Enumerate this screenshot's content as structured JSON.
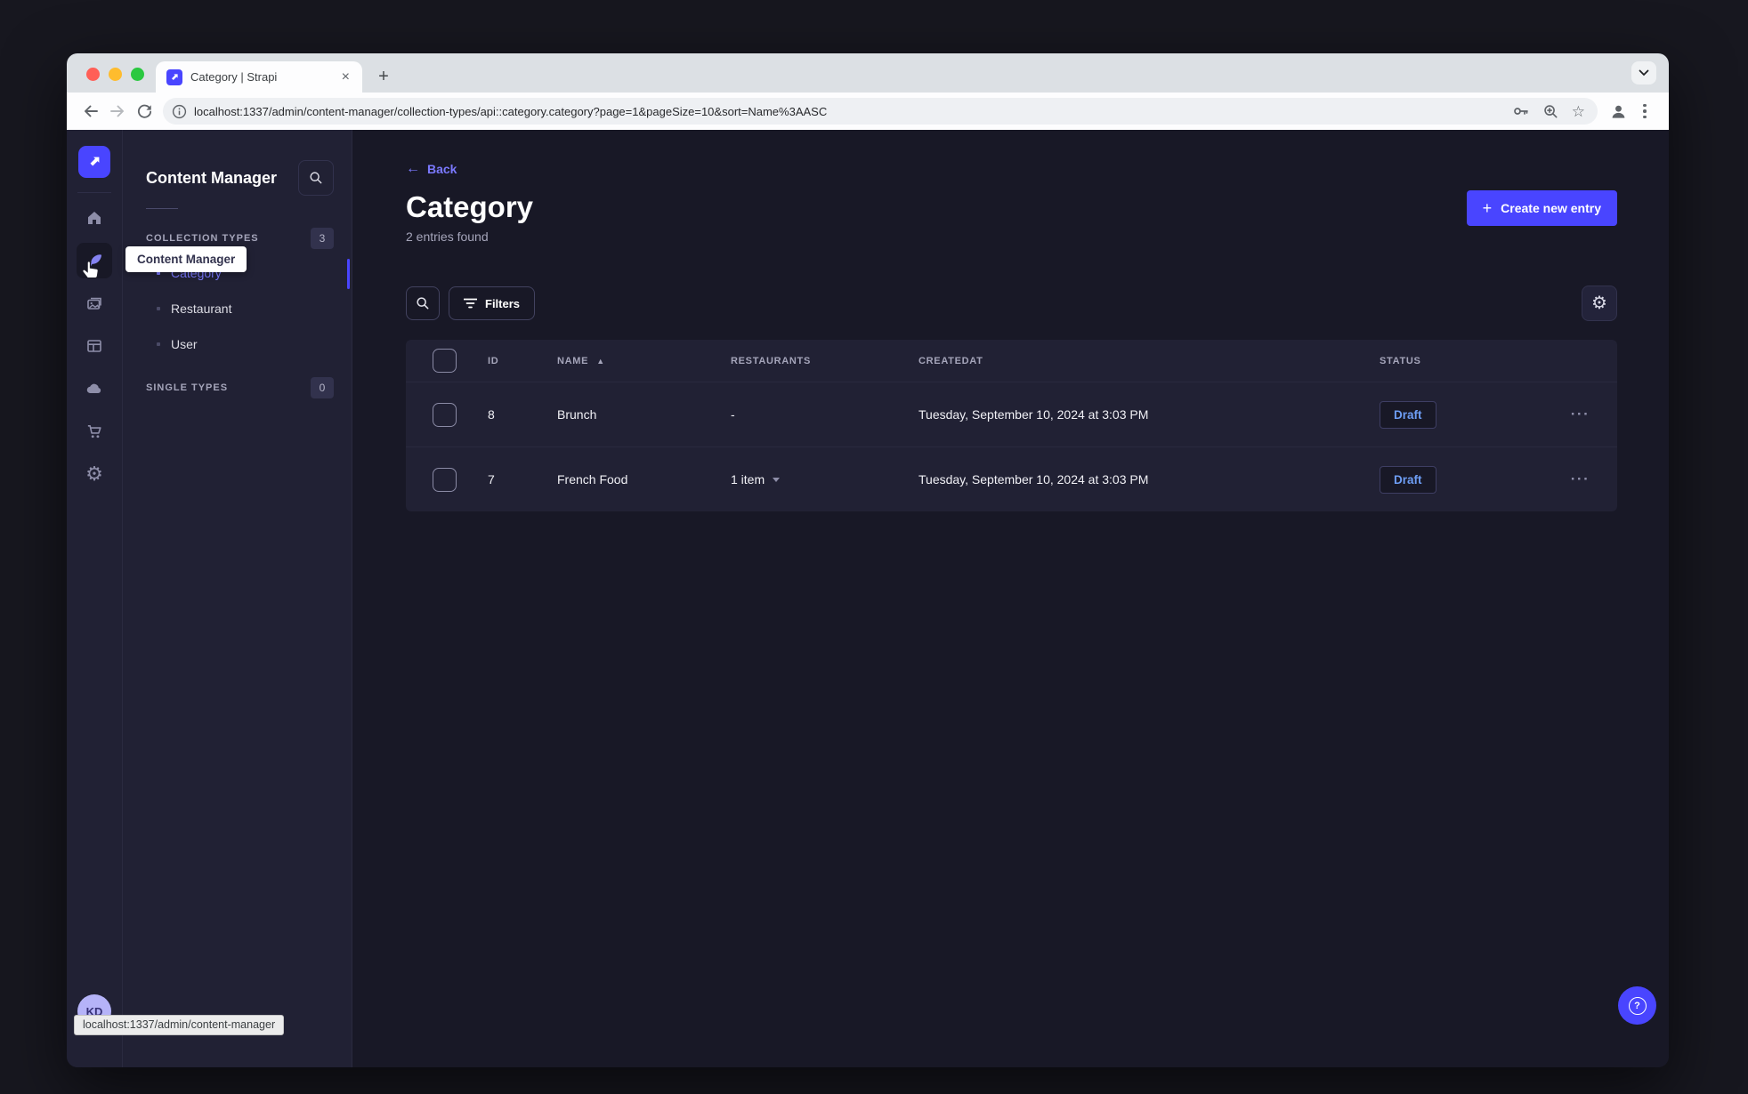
{
  "colors": {
    "primary": "#4945ff",
    "active_link": "#7b79ff",
    "draft_badge_text": "#6e9ef5",
    "app_background": "#181826",
    "surface": "#212134"
  },
  "browser": {
    "tab_title": "Category | Strapi",
    "new_tab_label": "+",
    "tab_close_label": "×",
    "url": "localhost:1337/admin/content-manager/collection-types/api::category.category?page=1&pageSize=10&sort=Name%3AASC",
    "status_preview": "localhost:1337/admin/content-manager"
  },
  "rail": {
    "tooltip": "Content Manager",
    "avatar_initials": "KD"
  },
  "subnav": {
    "title": "Content Manager",
    "collection_types_label": "COLLECTION TYPES",
    "collection_types_count": "3",
    "single_types_label": "SINGLE TYPES",
    "single_types_count": "0",
    "items": [
      {
        "label": "Category"
      },
      {
        "label": "Restaurant"
      },
      {
        "label": "User"
      }
    ]
  },
  "main": {
    "back_label": "Back",
    "back_arrow": "←",
    "title": "Category",
    "subtitle": "2 entries found",
    "create_button_label": "Create new entry",
    "create_plus": "+",
    "filters_button_label": "Filters",
    "sort_caret": "▲",
    "actions_glyph": "···",
    "help_glyph": "?",
    "table": {
      "headers": [
        "ID",
        "NAME",
        "RESTAURANTS",
        "CREATEDAT",
        "STATUS"
      ],
      "rows": [
        {
          "id": "8",
          "name": "Brunch",
          "restaurants": "-",
          "created_at": "Tuesday, September 10, 2024 at 3:03 PM",
          "status": "Draft"
        },
        {
          "id": "7",
          "name": "French Food",
          "restaurants": "1 item",
          "created_at": "Tuesday, September 10, 2024 at 3:03 PM",
          "status": "Draft"
        }
      ]
    }
  },
  "glyphs": {
    "gear": "⚙",
    "star": "☆"
  }
}
